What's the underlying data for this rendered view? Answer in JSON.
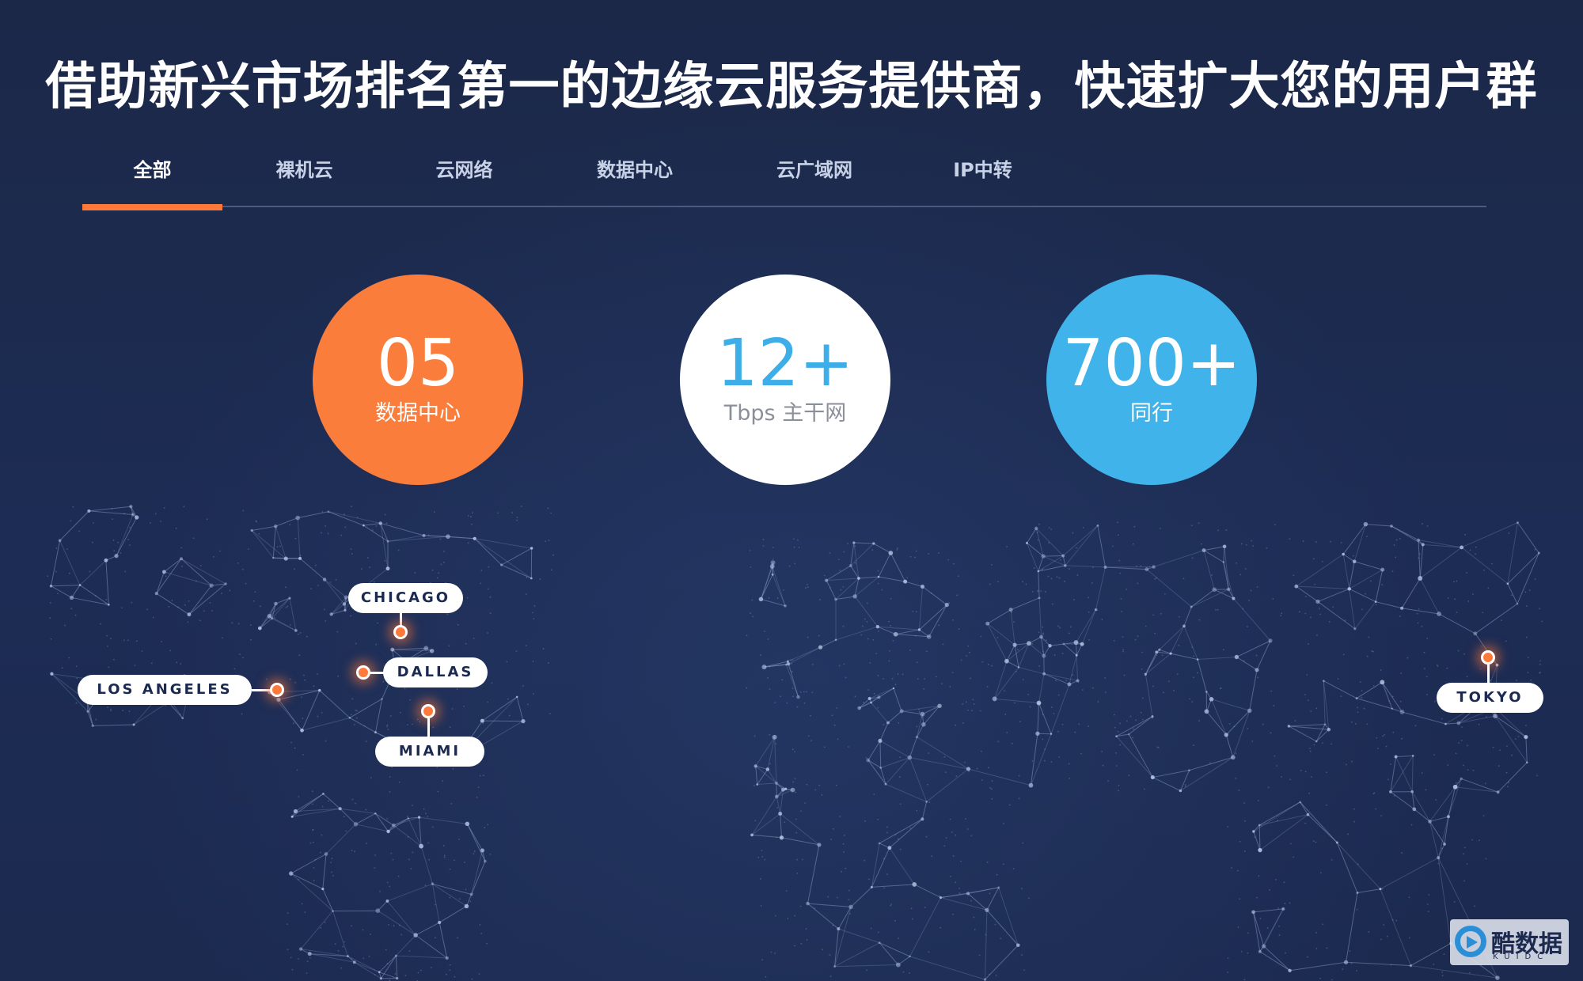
{
  "headline": "借助新兴市场排名第一的边缘云服务提供商，快速扩大您的用户群",
  "tabs": [
    {
      "label": "全部",
      "active": true
    },
    {
      "label": "裸机云",
      "active": false
    },
    {
      "label": "云网络",
      "active": false
    },
    {
      "label": "数据中心",
      "active": false
    },
    {
      "label": "云广域网",
      "active": false
    },
    {
      "label": "IP中转",
      "active": false
    }
  ],
  "stats": [
    {
      "value": "05",
      "label": "数据中心",
      "color": "#fa7d3c"
    },
    {
      "value": "12+",
      "label": "Tbps 主干网",
      "color": "#ffffff"
    },
    {
      "value": "700+",
      "label": "同行",
      "color": "#40b3ea"
    }
  ],
  "cities": [
    {
      "name": "CHICAGO"
    },
    {
      "name": "DALLAS"
    },
    {
      "name": "LOS ANGELES"
    },
    {
      "name": "MIAMI"
    },
    {
      "name": "TOKYO"
    }
  ],
  "watermark": {
    "name": "酷数据",
    "sub": "KUIDC"
  },
  "colors": {
    "background": "#1c2a50",
    "accent": "#ff7a3a",
    "tab_divider": "#4a5a80"
  }
}
